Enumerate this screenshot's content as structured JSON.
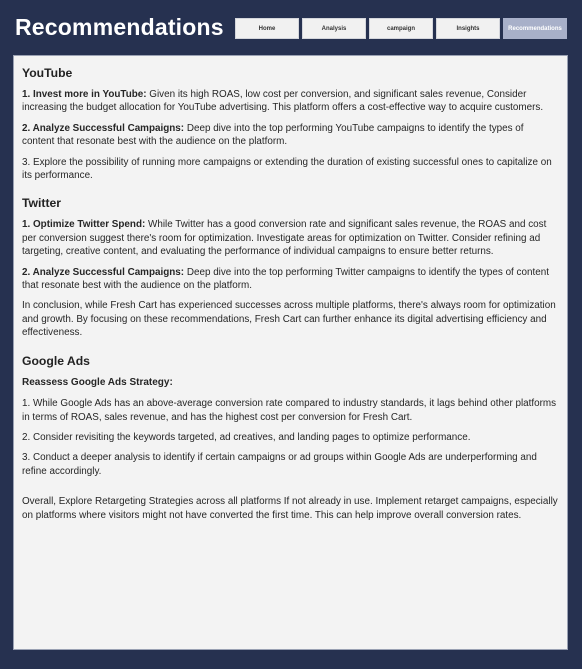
{
  "header": {
    "title": "Recommendations"
  },
  "nav": {
    "home": "Home",
    "analysis": "Analysis",
    "campaign": "campaign",
    "insights": "Insights",
    "recommendations": "Recommendations"
  },
  "youtube": {
    "title": "YouTube",
    "p1_lead": "1. Invest more in YouTube:",
    "p1_text": " Given its high ROAS, low cost per conversion, and significant sales revenue, Consider increasing the budget allocation for YouTube advertising. This platform offers a cost-effective way to acquire customers.",
    "p2_lead": "2. Analyze Successful Campaigns:",
    "p2_text": " Deep dive into the top performing YouTube campaigns to identify the types of content that resonate best with the audience on the platform.",
    "p3_text": "3. Explore the possibility of running more campaigns or extending the duration of existing successful ones to capitalize on its performance."
  },
  "twitter": {
    "title": "Twitter",
    "p1_lead": "1. Optimize Twitter Spend:",
    "p1_text": " While Twitter has a good conversion rate and significant sales revenue, the ROAS and cost per conversion suggest there's room for optimization. Investigate areas for optimization on Twitter. Consider refining ad targeting, creative content, and evaluating the performance of individual campaigns to ensure better returns.",
    "p2_lead": "2. Analyze Successful Campaigns:",
    "p2_text": " Deep dive into the top performing Twitter campaigns to identify the types of content that resonate best with the audience on the platform.",
    "conclusion": "In conclusion, while Fresh Cart has experienced successes across multiple platforms, there's always room for optimization and growth. By focusing on these recommendations, Fresh Cart can further enhance its digital advertising efficiency and effectiveness."
  },
  "google_ads": {
    "title": "Google Ads",
    "subhead": "Reassess Google Ads Strategy:",
    "p1_text": "1. While Google Ads has an above-average conversion rate compared to industry standards, it lags behind other platforms in terms of ROAS, sales revenue, and has the highest cost per conversion for Fresh Cart.",
    "p2_text": "2. Consider revisiting the keywords targeted, ad creatives, and landing pages to optimize performance.",
    "p3_text": "3. Conduct a deeper analysis to identify if certain campaigns or ad groups within Google Ads are underperforming and refine accordingly.",
    "overall": "Overall, Explore Retargeting Strategies across all platforms If not already in use. Implement retarget campaigns, especially on platforms where visitors might not have converted the first time. This can help improve overall conversion rates."
  }
}
